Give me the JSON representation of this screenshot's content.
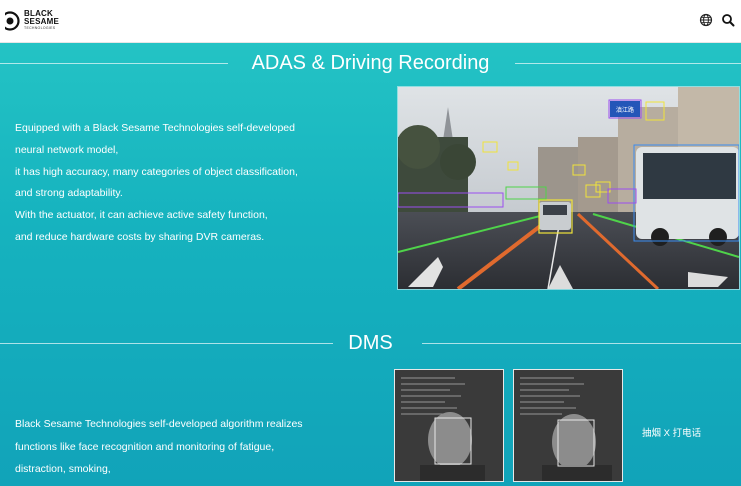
{
  "header": {
    "logo_line1": "BLACK",
    "logo_line2": "SESAME",
    "logo_line3": "TECHNOLOGIES",
    "icons": [
      "globe-icon",
      "search-icon"
    ]
  },
  "adas": {
    "title": "ADAS & Driving Recording",
    "lines": [
      "Equipped with a Black Sesame Technologies self-developed",
      "neural network model,",
      "it has high accuracy, many categories of object classification,",
      "and strong adaptability.",
      "With the actuator, it can achieve active safety function,",
      "and reduce hardware costs by sharing DVR cameras."
    ],
    "image_sign_text": "滇江路"
  },
  "dms": {
    "title": "DMS",
    "lines": [
      "Black Sesame Technologies self-developed algorithm realizes",
      "functions like face recognition and monitoring of fatigue,",
      "distraction, smoking,"
    ],
    "caption": "抽烟 X 打电话"
  },
  "colors": {
    "background_top": "#27c7c6",
    "background_bottom": "#11a3b9",
    "text": "#ffffff"
  }
}
